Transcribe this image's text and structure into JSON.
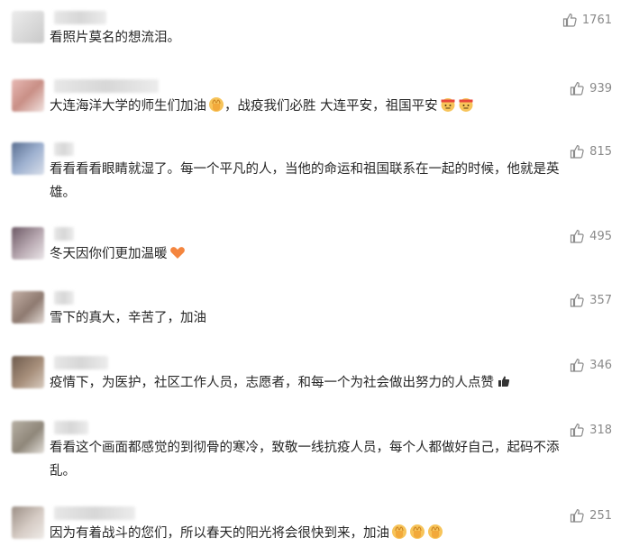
{
  "comments": [
    {
      "likes": "1761",
      "text": "看照片莫名的想流泪。",
      "emojis": []
    },
    {
      "likes": "939",
      "text": "大连海洋大学的师生们加油",
      "emojis": [
        "fist-emoji"
      ],
      "text2": "，战疫我们必胜 大连平安，祖国平安",
      "emojis2": [
        "fighting-face-emoji",
        "fighting-face-emoji"
      ]
    },
    {
      "likes": "815",
      "text": "看看看看眼睛就湿了。每一个平凡的人，当他的命运和祖国联系在一起的时候，他就是英雄。",
      "emojis": []
    },
    {
      "likes": "495",
      "text": "冬天因你们更加温暖",
      "emojis": [
        "heart-emoji"
      ]
    },
    {
      "likes": "357",
      "text": "雪下的真大，辛苦了，加油",
      "emojis": []
    },
    {
      "likes": "346",
      "text": "疫情下，为医护，社区工作人员，志愿者，和每一个为社会做出努力的人点赞",
      "emojis": [
        "thumbs-up-hand-emoji"
      ]
    },
    {
      "likes": "318",
      "text": "看看这个画面都感觉的到彻骨的寒冷，致敬一线抗疫人员，每个人都做好自己，起码不添乱。",
      "emojis": []
    },
    {
      "likes": "251",
      "text": "因为有着战斗的您们，所以春天的阳光将会很快到来，加油",
      "emojis": [
        "fist-emoji",
        "fist-emoji",
        "fist-emoji"
      ]
    }
  ],
  "colors": {
    "like_count": "#8a8a8a",
    "text": "#262626"
  }
}
